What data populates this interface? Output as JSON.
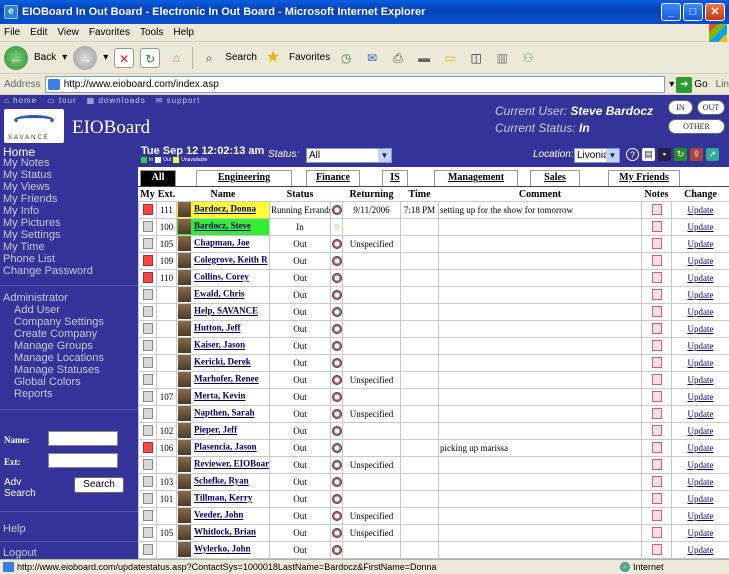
{
  "window": {
    "title": "EIOBoard In Out Board - Electronic In Out Board - Microsoft Internet Explorer",
    "buttons": [
      "_",
      "□",
      "✕"
    ]
  },
  "menu": [
    "File",
    "Edit",
    "View",
    "Favorites",
    "Tools",
    "Help"
  ],
  "toolbar": {
    "back_label": "Back",
    "search_label": "Search",
    "favorites_label": "Favorites"
  },
  "address": {
    "label": "Address",
    "url": "http://www.eioboard.com/index.asp",
    "go_label": "Go",
    "links_label": "Lin"
  },
  "header": {
    "nav": [
      "home",
      "tour",
      "downloads",
      "support"
    ],
    "logo_text": "SAVANCE",
    "app_title": "EIOBoard",
    "current_user_label": "Current User:",
    "current_user": "Steve Bardocz",
    "current_status_label": "Current Status:",
    "current_status": "In",
    "btn_in": "IN",
    "btn_out": "OUT",
    "btn_other": "OTHER"
  },
  "sidebar": {
    "items": [
      "Home",
      "My Notes",
      "My Status",
      "My Views",
      "My Friends",
      "My Info",
      "My Pictures",
      "My Settings",
      "My Time",
      "Phone List",
      "Change Password"
    ],
    "admin_label": "Administrator",
    "admin_items": [
      "Add User",
      "Company Settings",
      "Create Company",
      "Manage Groups",
      "Manage Locations",
      "Manage Statuses",
      "Global Colors",
      "Reports"
    ],
    "search": {
      "name_label": "Name:",
      "ext_label": "Ext:",
      "adv_label": "Adv",
      "search_label": "Search",
      "button": "Search"
    },
    "help": "Help",
    "logout": "Logout"
  },
  "controls": {
    "datetime": "Tue  Sep 12 12:02:13 am",
    "legend": [
      {
        "label": "In",
        "color": "#33cc33"
      },
      {
        "label": "Out",
        "color": "#ffffff"
      },
      {
        "label": "Unavailable",
        "color": "#ffff33"
      }
    ],
    "status_label": "Status:",
    "status_value": "All",
    "location_label": "Location:",
    "location_value": "Livonia"
  },
  "tabs": [
    "All",
    "Engineering",
    "Finance",
    "IS",
    "Management",
    "Sales",
    "My Friends"
  ],
  "table": {
    "headers": [
      "My",
      "Ext.",
      "Name",
      "Status",
      "Returning",
      "Time",
      "Comment",
      "Notes",
      "Change"
    ],
    "rows": [
      {
        "my": "red",
        "ext": "111",
        "name": "Bardocz, Donna",
        "hl": "yellow",
        "status": "Running Errands",
        "icon": "clock",
        "returning": "9/11/2006",
        "time": "7:18 PM",
        "comment": "setting up for the show for tomorrow",
        "update": "Update"
      },
      {
        "my": "gray",
        "ext": "100",
        "name": "Bardocz, Steve",
        "hl": "green",
        "status": "In",
        "icon": "sun",
        "returning": "",
        "time": "",
        "comment": "",
        "update": "Update"
      },
      {
        "my": "gray",
        "ext": "105",
        "name": "Chapman, Joe",
        "hl": "",
        "status": "Out",
        "icon": "clock",
        "returning": "Unspecified",
        "time": "",
        "comment": "",
        "update": "Update"
      },
      {
        "my": "red",
        "ext": "109",
        "name": "Colegrove, Keith R",
        "hl": "",
        "status": "Out",
        "icon": "clock",
        "returning": "",
        "time": "",
        "comment": "",
        "update": "Update"
      },
      {
        "my": "red",
        "ext": "110",
        "name": "Collins, Corey",
        "hl": "",
        "status": "Out",
        "icon": "clock",
        "returning": "",
        "time": "",
        "comment": "",
        "update": "Update"
      },
      {
        "my": "gray",
        "ext": "",
        "name": "Ewald, Chris",
        "hl": "",
        "status": "Out",
        "icon": "clock",
        "returning": "",
        "time": "",
        "comment": "",
        "update": "Update"
      },
      {
        "my": "gray",
        "ext": "",
        "name": "Help, SAVANCE",
        "hl": "",
        "status": "Out",
        "icon": "clock",
        "returning": "",
        "time": "",
        "comment": "",
        "update": "Update"
      },
      {
        "my": "gray",
        "ext": "",
        "name": "Hutton, Jeff",
        "hl": "",
        "status": "Out",
        "icon": "clock",
        "returning": "",
        "time": "",
        "comment": "",
        "update": "Update"
      },
      {
        "my": "gray",
        "ext": "",
        "name": "Kaiser, Jason",
        "hl": "",
        "status": "Out",
        "icon": "clock",
        "returning": "",
        "time": "",
        "comment": "",
        "update": "Update"
      },
      {
        "my": "gray",
        "ext": "",
        "name": "Kericki, Derek",
        "hl": "",
        "status": "Out",
        "icon": "clock",
        "returning": "",
        "time": "",
        "comment": "",
        "update": "Update"
      },
      {
        "my": "gray",
        "ext": "",
        "name": "Marhofer, Renee",
        "hl": "",
        "status": "Out",
        "icon": "clock",
        "returning": "Unspecified",
        "time": "",
        "comment": "",
        "update": "Update"
      },
      {
        "my": "gray",
        "ext": "107",
        "name": "Merta, Kevin",
        "hl": "",
        "status": "Out",
        "icon": "clock",
        "returning": "",
        "time": "",
        "comment": "",
        "update": "Update"
      },
      {
        "my": "gray",
        "ext": "",
        "name": "Napthen, Sarah",
        "hl": "",
        "status": "Out",
        "icon": "clock",
        "returning": "Unspecified",
        "time": "",
        "comment": "",
        "update": "Update"
      },
      {
        "my": "gray",
        "ext": "102",
        "name": "Pieper, Jeff",
        "hl": "",
        "status": "Out",
        "icon": "clock",
        "returning": "",
        "time": "",
        "comment": "",
        "update": "Update"
      },
      {
        "my": "red",
        "ext": "106",
        "name": "Plasencia, Jason",
        "hl": "",
        "status": "Out",
        "icon": "clock",
        "returning": "",
        "time": "",
        "comment": "picking up marissa",
        "update": "Update"
      },
      {
        "my": "gray",
        "ext": "",
        "name": "Reviewer, EIOBoard",
        "hl": "",
        "status": "Out",
        "icon": "clock",
        "returning": "Unspecified",
        "time": "",
        "comment": "",
        "update": "Update"
      },
      {
        "my": "gray",
        "ext": "103",
        "name": "Schefke, Ryan",
        "hl": "",
        "status": "Out",
        "icon": "clock",
        "returning": "",
        "time": "",
        "comment": "",
        "update": "Update"
      },
      {
        "my": "gray",
        "ext": "101",
        "name": "Tillman, Kerry",
        "hl": "",
        "status": "Out",
        "icon": "clock",
        "returning": "",
        "time": "",
        "comment": "",
        "update": "Update"
      },
      {
        "my": "gray",
        "ext": "",
        "name": "Veeder, John",
        "hl": "",
        "status": "Out",
        "icon": "clock",
        "returning": "Unspecified",
        "time": "",
        "comment": "",
        "update": "Update"
      },
      {
        "my": "gray",
        "ext": "105",
        "name": "Whitlock, Brian",
        "hl": "",
        "status": "Out",
        "icon": "clock",
        "returning": "Unspecified",
        "time": "",
        "comment": "",
        "update": "Update"
      },
      {
        "my": "gray",
        "ext": "",
        "name": "Wylerko, John",
        "hl": "",
        "status": "Out",
        "icon": "clock",
        "returning": "",
        "time": "",
        "comment": "",
        "update": "Update"
      }
    ]
  },
  "statusbar": {
    "url": "http://www.eioboard.com/updatestatus.asp?ContactSys=1000018LastName=Bardocz&FirstName=Donna",
    "zone": "Internet"
  }
}
